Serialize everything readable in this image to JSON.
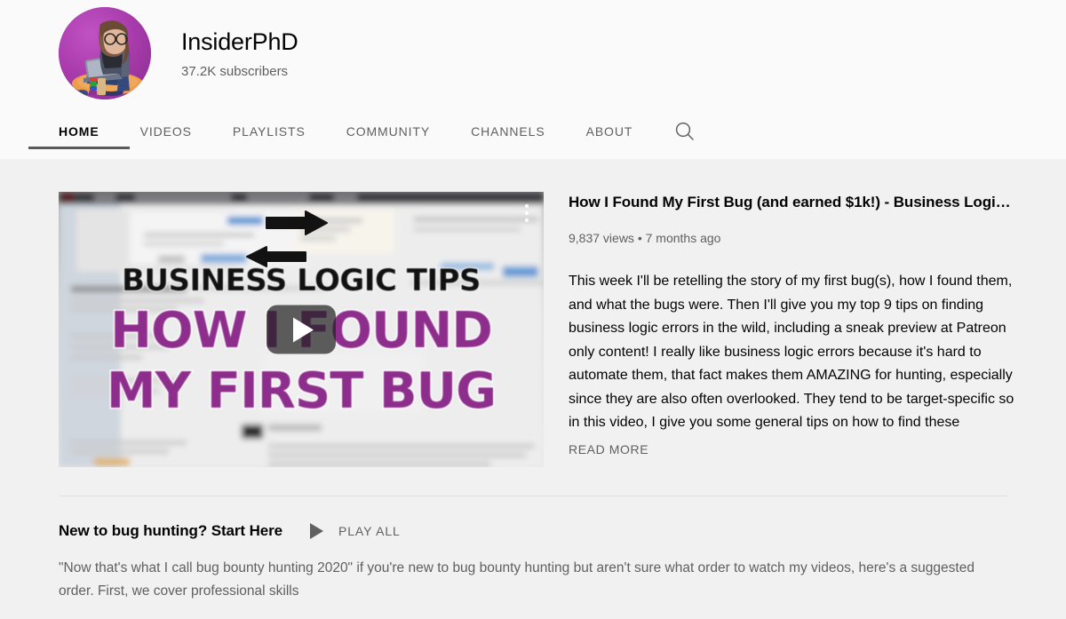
{
  "channel": {
    "name": "InsiderPhD",
    "subscribers": "37.2K subscribers",
    "avatar_icon": "channel-avatar-illustration"
  },
  "tabs": [
    {
      "label": "HOME",
      "active": true
    },
    {
      "label": "VIDEOS",
      "active": false
    },
    {
      "label": "PLAYLISTS",
      "active": false
    },
    {
      "label": "COMMUNITY",
      "active": false
    },
    {
      "label": "CHANNELS",
      "active": false
    },
    {
      "label": "ABOUT",
      "active": false
    }
  ],
  "search": {
    "icon": "search-icon"
  },
  "featured_video": {
    "title": "How I Found My First Bug (and earned $1k!) - Business Logi…",
    "views": "9,837 views",
    "separator": "•",
    "published": "7 months ago",
    "description": "This week I'll be retelling the story of my first bug(s), how I found them, and what the bugs were. Then I'll give you my top 9 tips on finding business logic errors in the wild, including a sneak preview at Patreon only content! I really like business logic errors because it's hard to automate them, that fact makes them AMAZING for hunting, especially since they are also often overlooked. They tend to be target-specific so in this video, I give you some general tips on how to find these",
    "read_more_label": "READ MORE",
    "thumbnail": {
      "line1": "BUSINESS LOGIC TIPS",
      "line2": "HOW I FOUND",
      "line3": "MY FIRST BUG",
      "play_icon": "play-button-icon",
      "menu_icon": "more-options-icon",
      "title_color": "#8e2e8c"
    }
  },
  "shelf": {
    "title": "New to bug hunting? Start Here",
    "play_all_label": "PLAY ALL",
    "play_all_icon": "play-icon",
    "description": "\"Now that's what I call bug bounty hunting 2020\" if you're new to bug bounty hunting but aren't sure what order to watch my videos, here's a suggested order. First, we cover professional skills"
  },
  "colors": {
    "header_bg": "#fafafa",
    "page_bg": "#f1f1f1",
    "active_tab_underline": "#5a5a5a",
    "primary_text": "#030303",
    "secondary_text": "#606060"
  }
}
